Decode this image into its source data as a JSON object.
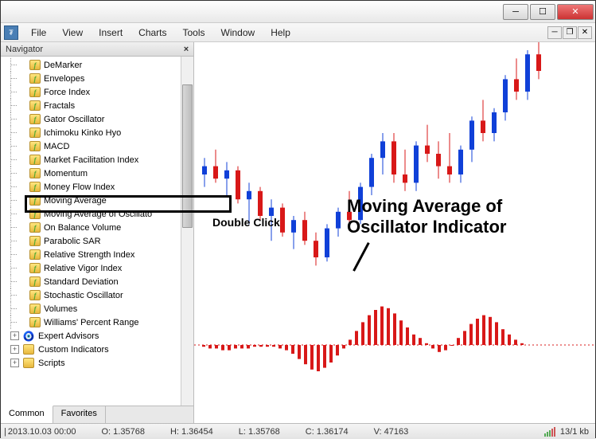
{
  "menu": {
    "file": "File",
    "view": "View",
    "insert": "Insert",
    "charts": "Charts",
    "tools": "Tools",
    "window": "Window",
    "help": "Help"
  },
  "navigator": {
    "title": "Navigator",
    "items": [
      "DeMarker",
      "Envelopes",
      "Force Index",
      "Fractals",
      "Gator Oscillator",
      "Ichimoku Kinko Hyo",
      "MACD",
      "Market Facilitation Index",
      "Momentum",
      "Money Flow Index",
      "Moving Average",
      "Moving Average of Oscillato",
      "On Balance Volume",
      "Parabolic SAR",
      "Relative Strength Index",
      "Relative Vigor Index",
      "Standard Deviation",
      "Stochastic Oscillator",
      "Volumes",
      "Williams' Percent Range"
    ],
    "groups": {
      "ea": "Expert Advisors",
      "ci": "Custom Indicators",
      "sc": "Scripts"
    },
    "tabs": {
      "common": "Common",
      "favorites": "Favorites"
    }
  },
  "annotations": {
    "double_click": "Double Click",
    "big_label_l1": "Moving Average of",
    "big_label_l2": "Oscillator Indicator"
  },
  "status": {
    "datetime": "2013.10.03 00:00",
    "open": "O: 1.35768",
    "high": "H: 1.36454",
    "low": "L: 1.35768",
    "close": "C: 1.36174",
    "volume": "V: 47163",
    "kb": "13/1 kb"
  },
  "chart_data": {
    "type": "candlestick+histogram",
    "note": "values approximate, read from pixel positions",
    "y_price_range": [
      1.34,
      1.39
    ],
    "candles": [
      {
        "x": 0,
        "o": 1.36,
        "h": 1.364,
        "l": 1.357,
        "c": 1.362,
        "color": "blue"
      },
      {
        "x": 1,
        "o": 1.362,
        "h": 1.366,
        "l": 1.358,
        "c": 1.359,
        "color": "red"
      },
      {
        "x": 2,
        "o": 1.359,
        "h": 1.363,
        "l": 1.355,
        "c": 1.361,
        "color": "blue"
      },
      {
        "x": 3,
        "o": 1.361,
        "h": 1.362,
        "l": 1.353,
        "c": 1.354,
        "color": "red"
      },
      {
        "x": 4,
        "o": 1.354,
        "h": 1.358,
        "l": 1.348,
        "c": 1.356,
        "color": "blue"
      },
      {
        "x": 5,
        "o": 1.356,
        "h": 1.357,
        "l": 1.349,
        "c": 1.35,
        "color": "red"
      },
      {
        "x": 6,
        "o": 1.35,
        "h": 1.354,
        "l": 1.344,
        "c": 1.352,
        "color": "blue"
      },
      {
        "x": 7,
        "o": 1.352,
        "h": 1.353,
        "l": 1.345,
        "c": 1.346,
        "color": "red"
      },
      {
        "x": 8,
        "o": 1.346,
        "h": 1.35,
        "l": 1.342,
        "c": 1.349,
        "color": "blue"
      },
      {
        "x": 9,
        "o": 1.349,
        "h": 1.351,
        "l": 1.343,
        "c": 1.344,
        "color": "red"
      },
      {
        "x": 10,
        "o": 1.344,
        "h": 1.346,
        "l": 1.338,
        "c": 1.34,
        "color": "red"
      },
      {
        "x": 11,
        "o": 1.34,
        "h": 1.348,
        "l": 1.339,
        "c": 1.347,
        "color": "blue"
      },
      {
        "x": 12,
        "o": 1.347,
        "h": 1.352,
        "l": 1.345,
        "c": 1.351,
        "color": "blue"
      },
      {
        "x": 13,
        "o": 1.351,
        "h": 1.356,
        "l": 1.348,
        "c": 1.349,
        "color": "red"
      },
      {
        "x": 14,
        "o": 1.349,
        "h": 1.358,
        "l": 1.348,
        "c": 1.357,
        "color": "blue"
      },
      {
        "x": 15,
        "o": 1.357,
        "h": 1.365,
        "l": 1.355,
        "c": 1.364,
        "color": "blue"
      },
      {
        "x": 16,
        "o": 1.364,
        "h": 1.37,
        "l": 1.36,
        "c": 1.368,
        "color": "blue"
      },
      {
        "x": 17,
        "o": 1.368,
        "h": 1.37,
        "l": 1.358,
        "c": 1.36,
        "color": "red"
      },
      {
        "x": 18,
        "o": 1.36,
        "h": 1.366,
        "l": 1.356,
        "c": 1.358,
        "color": "red"
      },
      {
        "x": 19,
        "o": 1.358,
        "h": 1.368,
        "l": 1.356,
        "c": 1.367,
        "color": "blue"
      },
      {
        "x": 20,
        "o": 1.367,
        "h": 1.372,
        "l": 1.363,
        "c": 1.365,
        "color": "red"
      },
      {
        "x": 21,
        "o": 1.365,
        "h": 1.368,
        "l": 1.359,
        "c": 1.362,
        "color": "red"
      },
      {
        "x": 22,
        "o": 1.362,
        "h": 1.37,
        "l": 1.358,
        "c": 1.36,
        "color": "red"
      },
      {
        "x": 23,
        "o": 1.36,
        "h": 1.367,
        "l": 1.358,
        "c": 1.366,
        "color": "blue"
      },
      {
        "x": 24,
        "o": 1.366,
        "h": 1.374,
        "l": 1.363,
        "c": 1.373,
        "color": "blue"
      },
      {
        "x": 25,
        "o": 1.373,
        "h": 1.378,
        "l": 1.368,
        "c": 1.37,
        "color": "red"
      },
      {
        "x": 26,
        "o": 1.37,
        "h": 1.376,
        "l": 1.368,
        "c": 1.375,
        "color": "blue"
      },
      {
        "x": 27,
        "o": 1.375,
        "h": 1.384,
        "l": 1.373,
        "c": 1.383,
        "color": "blue"
      },
      {
        "x": 28,
        "o": 1.383,
        "h": 1.388,
        "l": 1.378,
        "c": 1.38,
        "color": "red"
      },
      {
        "x": 29,
        "o": 1.38,
        "h": 1.39,
        "l": 1.378,
        "c": 1.389,
        "color": "blue"
      },
      {
        "x": 30,
        "o": 1.389,
        "h": 1.392,
        "l": 1.383,
        "c": 1.385,
        "color": "red"
      }
    ],
    "oscillator": [
      -1,
      -2,
      -2,
      -3,
      -3,
      -2,
      -2,
      -2,
      -1,
      -1,
      -1,
      -1,
      -2,
      -3,
      -5,
      -8,
      -11,
      -14,
      -15,
      -13,
      -10,
      -6,
      -2,
      3,
      8,
      13,
      17,
      20,
      22,
      21,
      18,
      14,
      10,
      6,
      4,
      1,
      -2,
      -4,
      -3,
      0,
      4,
      8,
      12,
      15,
      17,
      16,
      13,
      9,
      6,
      3,
      1
    ]
  }
}
